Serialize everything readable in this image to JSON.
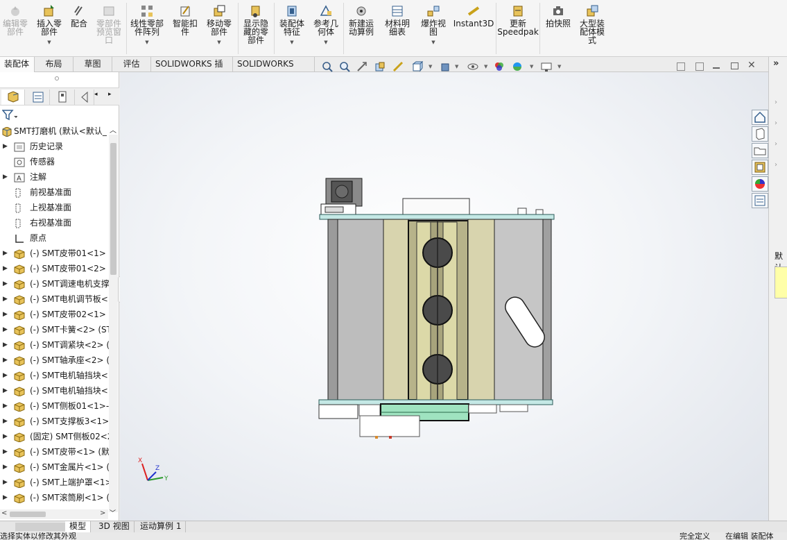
{
  "ribbon": {
    "buttons": [
      {
        "label": "编辑零\n部件",
        "disabled": true
      },
      {
        "label": "插入零\n部件",
        "disabled": false
      },
      {
        "label": "配合",
        "disabled": false
      },
      {
        "label": "零部件\n预览窗\n口",
        "disabled": true
      },
      {
        "label": "线性零部\n件阵列",
        "disabled": false
      },
      {
        "label": "智能扣\n件",
        "disabled": false
      },
      {
        "label": "移动零\n部件",
        "disabled": false
      },
      {
        "label": "显示隐\n藏的零\n部件",
        "disabled": false
      },
      {
        "label": "装配体\n特征",
        "disabled": false
      },
      {
        "label": "参考几\n何体",
        "disabled": false
      },
      {
        "label": "新建运\n动算例",
        "disabled": false
      },
      {
        "label": "材料明\n细表",
        "disabled": false
      },
      {
        "label": "爆炸视\n图",
        "disabled": false
      },
      {
        "label": "Instant3D",
        "disabled": false
      },
      {
        "label": "更新\nSpeedpak",
        "disabled": false
      },
      {
        "label": "拍快照",
        "disabled": false
      },
      {
        "label": "大型装\n配体模\n式",
        "disabled": false
      }
    ]
  },
  "tabs": [
    "装配体",
    "布局",
    "草图",
    "评估",
    "SOLIDWORKS 插件",
    "SOLIDWORKS MBD"
  ],
  "tree": {
    "root": "SMT打磨机  (默认<默认_",
    "items": [
      {
        "label": "历史记录",
        "icon": "history-icon",
        "arrow": true
      },
      {
        "label": "传感器",
        "icon": "sensor-icon",
        "arrow": false
      },
      {
        "label": "注解",
        "icon": "annotation-icon",
        "arrow": true
      },
      {
        "label": "前视基准面",
        "icon": "plane-icon",
        "arrow": false
      },
      {
        "label": "上视基准面",
        "icon": "plane-icon",
        "arrow": false
      },
      {
        "label": "右视基准面",
        "icon": "plane-icon",
        "arrow": false
      },
      {
        "label": "原点",
        "icon": "origin-icon",
        "arrow": false
      },
      {
        "label": "(-) SMT皮带01<1> (",
        "icon": "part-icon",
        "arrow": true
      },
      {
        "label": "(-) SMT皮带01<2> (",
        "icon": "part-icon",
        "arrow": true
      },
      {
        "label": "(-) SMT调速电机支撑",
        "icon": "part-icon",
        "arrow": true
      },
      {
        "label": "(-) SMT电机调节板<",
        "icon": "part-icon",
        "arrow": true
      },
      {
        "label": "(-) SMT皮带02<1> (",
        "icon": "part-icon",
        "arrow": true
      },
      {
        "label": "(-) SMT卡簧<2> (ST",
        "icon": "part-icon",
        "arrow": true
      },
      {
        "label": "(-) SMT调紧块<2> (",
        "icon": "part-icon",
        "arrow": true
      },
      {
        "label": "(-) SMT轴承座<2> (",
        "icon": "part-icon",
        "arrow": true
      },
      {
        "label": "(-) SMT电机轴挡块<",
        "icon": "part-icon",
        "arrow": true
      },
      {
        "label": "(-) SMT电机轴挡块<",
        "icon": "part-icon",
        "arrow": true
      },
      {
        "label": "(-) SMT侧板01<1>-",
        "icon": "part-icon",
        "arrow": true
      },
      {
        "label": "(-) SMT支撑板3<1>",
        "icon": "part-icon",
        "arrow": true
      },
      {
        "label": "(固定) SMT侧板02<2",
        "icon": "part-icon",
        "arrow": true
      },
      {
        "label": "(-) SMT皮带<1> (默",
        "icon": "part-icon",
        "arrow": true
      },
      {
        "label": "(-) SMT金属片<1> (",
        "icon": "part-icon",
        "arrow": true
      },
      {
        "label": "(-) SMT上端护罩<1>",
        "icon": "part-icon",
        "arrow": true
      },
      {
        "label": "(-) SMT滚筒刷<1> (",
        "icon": "part-icon",
        "arrow": true
      }
    ]
  },
  "bottom_tabs": [
    "模型",
    "3D 视图",
    "运动算例 1"
  ],
  "status": {
    "left": "选择实体以修改其外观",
    "right": [
      "完全定义",
      "在编辑 装配体"
    ]
  },
  "right_pane_label": "默认",
  "triad": {
    "x": "X",
    "y": "Y",
    "z": "Z"
  }
}
